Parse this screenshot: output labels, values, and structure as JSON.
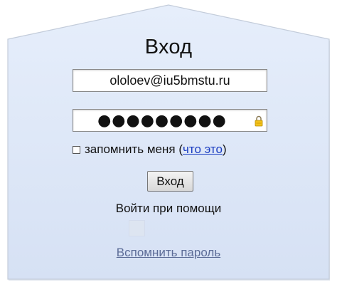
{
  "form": {
    "title": "Вход",
    "email_value": "ololoev@iu5bmstu.ru",
    "password_value": "●●●●●●●●●",
    "remember_label": "запомнить меня",
    "remember_checked": false,
    "paren_open": "(",
    "what_link": "что это",
    "paren_close": ")",
    "login_button": "Вход",
    "social_label": "Войти при помощи",
    "restore_link": "Вспомнить пароль"
  },
  "colors": {
    "panel_fill": "#dce6f7",
    "panel_border": "#c7cfdc",
    "link": "#1a3dc1",
    "restore_link": "#5d6d98",
    "lock": "#e8b200"
  },
  "icons": {
    "password_lock": "lock-icon",
    "remember_checkbox": "checkbox"
  }
}
